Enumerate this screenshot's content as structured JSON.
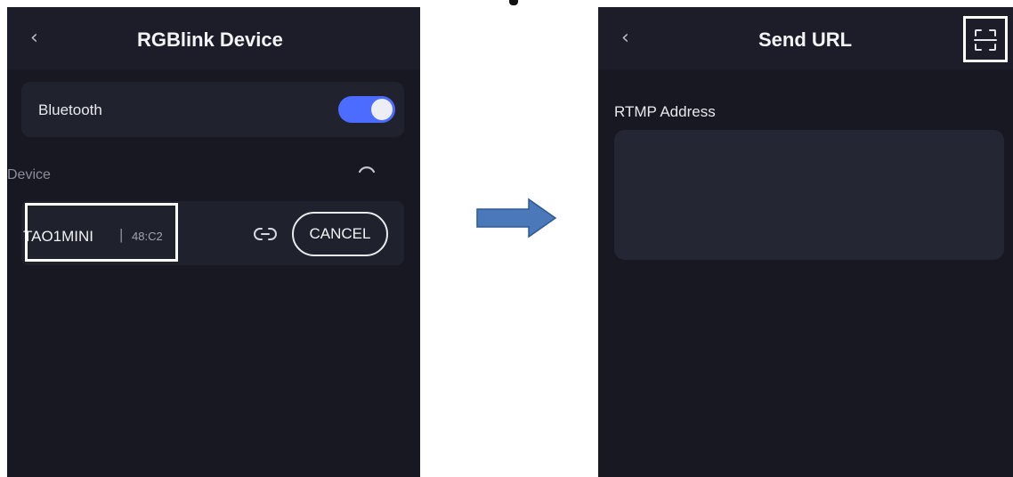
{
  "left_screen": {
    "back_icon": "chevron-left-icon",
    "back_glyph": "‹",
    "title": "RGBlink Device",
    "bluetooth": {
      "label": "Bluetooth",
      "enabled": true,
      "toggle_color": "#4c6cff"
    },
    "device_section_label": "Device",
    "spinner_icon": "loading-spinner-icon",
    "device": {
      "name": "TAO1MINI",
      "separator": "|",
      "mac": "48:C2",
      "link_icon": "link-icon"
    },
    "cancel_label": "CANCEL"
  },
  "arrow": {
    "icon": "right-arrow-icon",
    "color": "#4a78b8"
  },
  "right_screen": {
    "back_icon": "chevron-left-icon",
    "back_glyph": "‹",
    "title": "Send URL",
    "scan_icon": "scan-qr-icon",
    "field_label": "RTMP Address",
    "rtmp_value": ""
  },
  "colors": {
    "screen_bg": "#171821",
    "card_bg": "#20222e",
    "accent": "#4c6cff",
    "highlight_box": "#ffffff"
  }
}
